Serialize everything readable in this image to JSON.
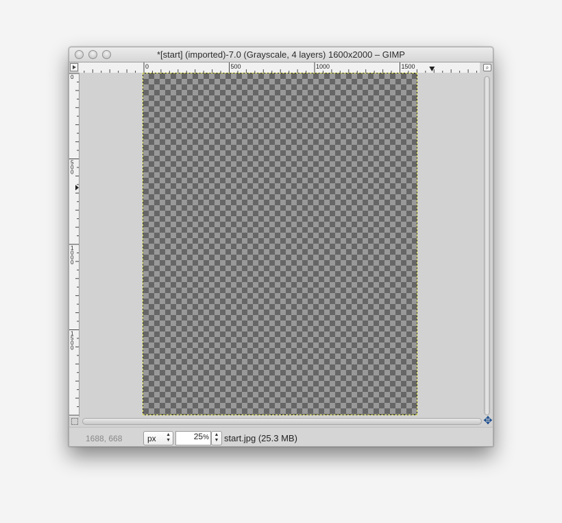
{
  "window": {
    "title": "*[start] (imported)-7.0 (Grayscale, 4 layers) 1600x2000 – GIMP"
  },
  "rulers": {
    "horizontal_labels": [
      "0",
      "500",
      "1000",
      "1500"
    ],
    "vertical_labels": [
      "0",
      "500",
      "1000",
      "1500"
    ],
    "horizontal_marker_value": 1688,
    "vertical_marker_value": 668
  },
  "icons": {
    "ruler_corner": "play-triangle-icon",
    "zoom_fit": "zoom-magnifier-icon",
    "quick_mask": "quick-mask-icon",
    "navigate": "navigate-cross-icon"
  },
  "colors": {
    "checker_dark": "#666666",
    "checker_light": "#999999",
    "selection_outline": "#d8d846"
  },
  "statusbar": {
    "coords": "1688, 668",
    "unit": "px",
    "zoom": "25",
    "zoom_suffix": "%",
    "status_text": "start.jpg (25.3 MB)"
  }
}
